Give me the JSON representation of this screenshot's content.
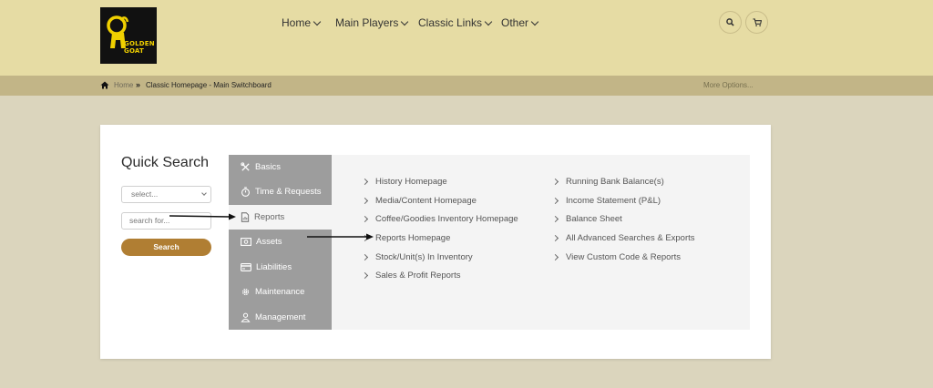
{
  "header": {
    "logo_text_line1": "GOLDEN",
    "logo_text_line2": "GOAT",
    "nav": [
      "Home",
      "Main Players",
      "Classic Links",
      "Other"
    ],
    "search_icon": "search-icon",
    "cart_icon": "cart-icon"
  },
  "breadcrumb": {
    "home": "Home",
    "separator": "»",
    "current": "Classic Homepage - Main Switchboard",
    "more": "More Options..."
  },
  "quick_search": {
    "title": "Quick Search",
    "select_placeholder": "select...",
    "input_placeholder": "search for...",
    "button": "Search"
  },
  "menu": [
    {
      "label": "Basics",
      "icon": "tools-icon",
      "active": false
    },
    {
      "label": "Time & Requests",
      "icon": "stopwatch-icon",
      "active": false
    },
    {
      "label": "Reports",
      "icon": "report-icon",
      "active": true
    },
    {
      "label": "Assets",
      "icon": "cash-icon",
      "active": false
    },
    {
      "label": "Liabilities",
      "icon": "card-icon",
      "active": false
    },
    {
      "label": "Maintenance",
      "icon": "gear-icon",
      "active": false
    },
    {
      "label": "Management",
      "icon": "user-icon",
      "active": false
    }
  ],
  "links": {
    "left": [
      "History Homepage",
      "Media/Content Homepage",
      "Coffee/Goodies Inventory Homepage",
      "Reports Homepage",
      "Stock/Unit(s) In Inventory",
      "Sales & Profit Reports"
    ],
    "right": [
      "Running Bank Balance(s)",
      "Income Statement (P&L)",
      "Balance Sheet",
      "All Advanced Searches & Exports",
      "View Custom Code & Reports"
    ]
  },
  "colors": {
    "header_bg": "#e6dca4",
    "breadcrumb_bg": "#c2b587",
    "page_bg": "#dbd5bd",
    "menu_bg": "#9d9d9d",
    "button_bg": "#b07e33"
  }
}
